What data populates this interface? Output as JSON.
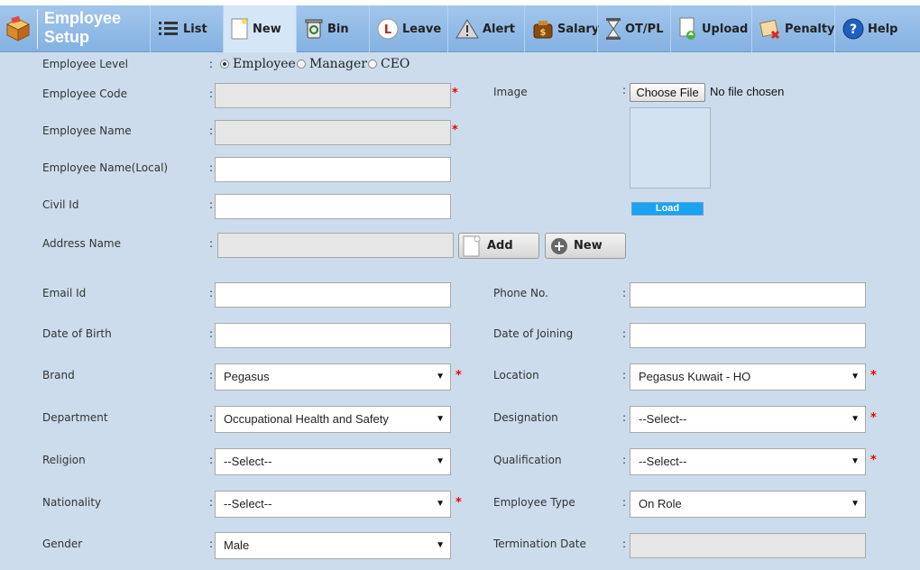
{
  "app": {
    "title": "Employee Setup",
    "icon": "package-icon"
  },
  "toolbar": {
    "items": [
      {
        "label": "List",
        "icon": "list-icon"
      },
      {
        "label": "New",
        "icon": "new-document-icon"
      },
      {
        "label": "Bin",
        "icon": "recycle-bin-icon"
      },
      {
        "label": "Leave",
        "icon": "leave-icon"
      },
      {
        "label": "Alert",
        "icon": "alert-icon"
      },
      {
        "label": "Salary",
        "icon": "money-bag-icon"
      },
      {
        "label": "OT/PL",
        "icon": "hourglass-icon"
      },
      {
        "label": "Upload",
        "icon": "upload-icon"
      },
      {
        "label": "Penalty",
        "icon": "penalty-icon"
      },
      {
        "label": "Help",
        "icon": "help-icon"
      }
    ]
  },
  "form": {
    "employee_level": {
      "label": "Employee Level",
      "options": [
        "Employee",
        "Manager",
        "CEO"
      ],
      "selected": "Employee"
    },
    "employee_code": {
      "label": "Employee Code",
      "value": ""
    },
    "employee_name": {
      "label": "Employee Name",
      "value": ""
    },
    "employee_name_local": {
      "label": "Employee Name(Local)",
      "value": ""
    },
    "civil_id": {
      "label": "Civil Id",
      "value": ""
    },
    "address_name": {
      "label": "Address Name",
      "value": "",
      "add_label": "Add",
      "new_label": "New"
    },
    "image": {
      "label": "Image",
      "choose_label": "Choose File",
      "file_status": "No file chosen",
      "load_label": "Load"
    },
    "email_id": {
      "label": "Email Id",
      "value": ""
    },
    "phone_no": {
      "label": "Phone No.",
      "value": ""
    },
    "date_of_birth": {
      "label": "Date of Birth",
      "value": ""
    },
    "date_of_joining": {
      "label": "Date of Joining",
      "value": ""
    },
    "brand": {
      "label": "Brand",
      "value": "Pegasus"
    },
    "location": {
      "label": "Location",
      "value": "Pegasus Kuwait - HO"
    },
    "department": {
      "label": "Department",
      "value": "Occupational Health and Safety"
    },
    "designation": {
      "label": "Designation",
      "value": "--Select--"
    },
    "religion": {
      "label": "Religion",
      "value": "--Select--"
    },
    "qualification": {
      "label": "Qualification",
      "value": "--Select--"
    },
    "nationality": {
      "label": "Nationality",
      "value": "--Select--"
    },
    "employee_type": {
      "label": "Employee Type",
      "value": "On Role"
    },
    "gender": {
      "label": "Gender",
      "value": "Male"
    },
    "termination_date": {
      "label": "Termination Date",
      "value": ""
    }
  },
  "symbols": {
    "colon": ":",
    "required": "*",
    "dropdown": "▼"
  },
  "colors": {
    "toolbar": "#94bbe6",
    "background": "#ccdcec",
    "required": "#ee0000",
    "load_button": "#1aa3f1"
  }
}
